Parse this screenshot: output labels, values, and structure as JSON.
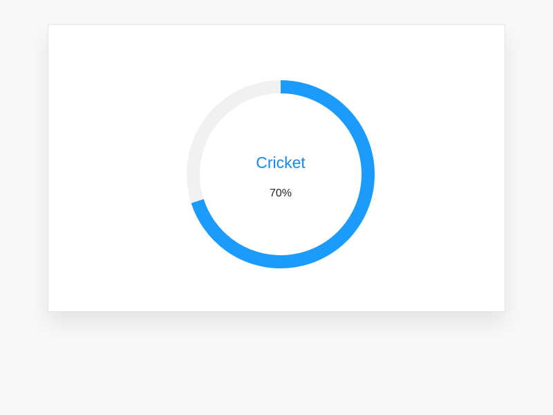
{
  "widget": {
    "title": "Cricket",
    "progress_label": "70%",
    "progress_value": 0.7,
    "colors": {
      "progress": "#1b9cfc",
      "track": "#f1f1f1",
      "title": "#1589f0"
    }
  }
}
